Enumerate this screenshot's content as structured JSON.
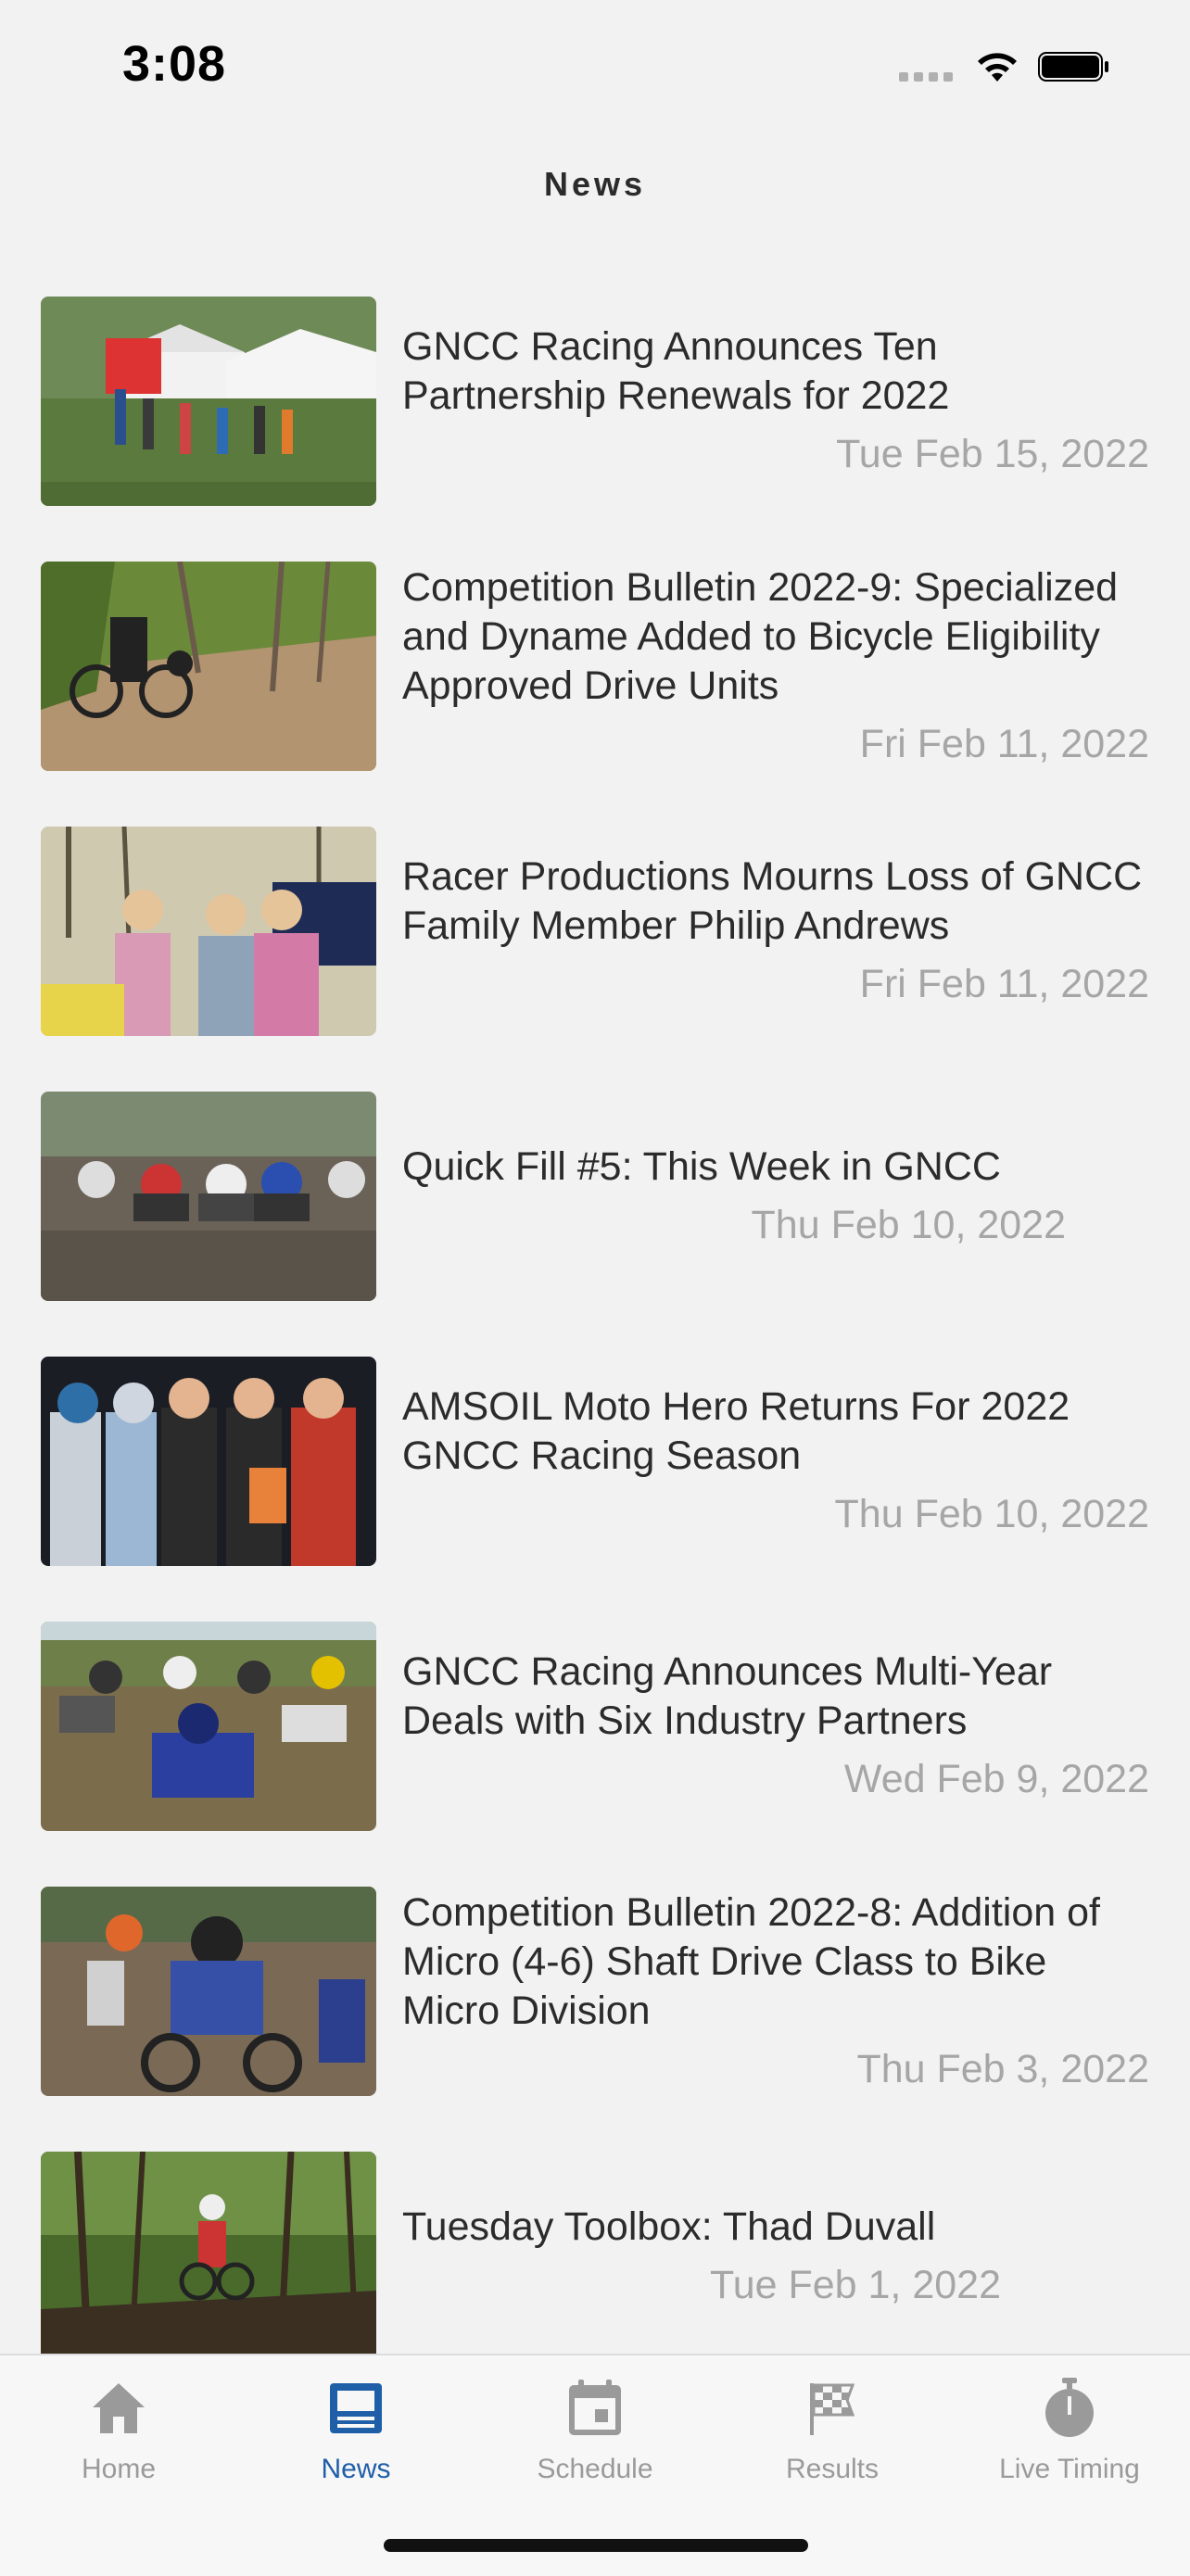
{
  "status_bar": {
    "time": "3:08"
  },
  "header": {
    "title": "News"
  },
  "news": [
    {
      "title": "GNCC Racing Announces Ten Partnership Renewals for 2022",
      "date": "Tue Feb 15, 2022"
    },
    {
      "title": "Competition Bulletin 2022-9: Specialized and Dyname Added to Bicycle Eligibility Approved Drive Units",
      "date": "Fri Feb 11, 2022"
    },
    {
      "title": "Racer Productions Mourns Loss of GNCC Family Member Philip Andrews",
      "date": "Fri Feb 11, 2022"
    },
    {
      "title": "Quick Fill #5: This Week in GNCC",
      "date": "Thu Feb 10, 2022"
    },
    {
      "title": "AMSOIL Moto Hero Returns For 2022 GNCC Racing Season",
      "date": "Thu Feb 10, 2022"
    },
    {
      "title": "GNCC Racing Announces Multi-Year Deals with Six Industry Partners",
      "date": "Wed Feb 9, 2022"
    },
    {
      "title": "Competition Bulletin 2022-8: Addition of Micro (4-6) Shaft Drive Class to Bike Micro Division",
      "date": "Thu Feb 3, 2022"
    },
    {
      "title": "Tuesday Toolbox: Thad Duvall",
      "date": "Tue Feb 1, 2022"
    }
  ],
  "tabs": [
    {
      "label": "Home",
      "icon": "home-icon",
      "active": false
    },
    {
      "label": "News",
      "icon": "newspaper-icon",
      "active": true
    },
    {
      "label": "Schedule",
      "icon": "calendar-icon",
      "active": false
    },
    {
      "label": "Results",
      "icon": "checkered-flag-icon",
      "active": false
    },
    {
      "label": "Live Timing",
      "icon": "stopwatch-icon",
      "active": false
    }
  ],
  "colors": {
    "background": "#f2f2f2",
    "accent": "#1f5fa8",
    "inactive": "#9a9a9a",
    "date_text": "#a6a6a6"
  }
}
